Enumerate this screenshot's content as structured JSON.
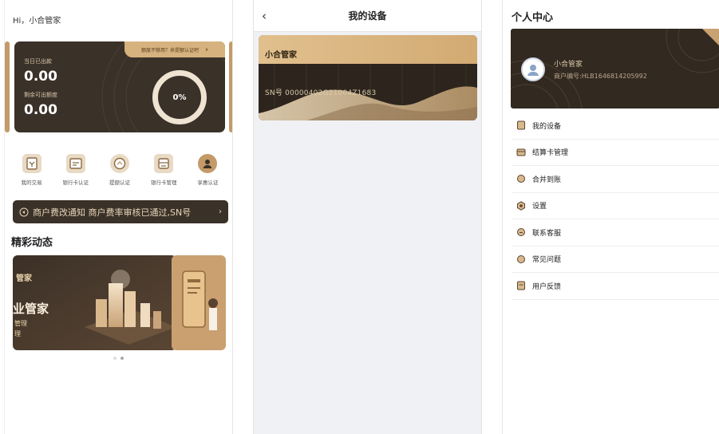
{
  "home": {
    "greeting": "Hi，小合管家",
    "quota_banner": "额度不够用？来提额认证吧",
    "quota_banner_arrow": "›",
    "today_label": "当日已出款",
    "today_value": "0.00",
    "remaining_label": "剩余可出额度",
    "remaining_value": "0.00",
    "progress_text": "0%",
    "quick_items": [
      {
        "label": "我的交易",
        "icon": "transaction-icon"
      },
      {
        "label": "银行卡认证",
        "icon": "bank-card-auth-icon"
      },
      {
        "label": "提额认证",
        "icon": "raise-limit-icon"
      },
      {
        "label": "银行卡管理",
        "icon": "bank-card-manage-icon"
      },
      {
        "label": "享惠认证",
        "icon": "benefit-auth-icon"
      }
    ],
    "notice_text": "商户费改通知  商户费率审核已通过,SN号",
    "notice_arrow": "›",
    "section_title": "精彩动态",
    "banner_text_1": "管家",
    "banner_text_2": "业管家",
    "banner_text_3": "管理",
    "banner_text_4": "理"
  },
  "device": {
    "back_icon": "‹",
    "title": "我的设备",
    "card_name": "小合管家",
    "card_sn": "SN号   00000402G21004Z1683"
  },
  "profile": {
    "title": "个人中心",
    "name": "小合管家",
    "merchant_id": "商户编号:HLB1646814205992",
    "menu": [
      {
        "label": "我的设备",
        "icon": "device-icon"
      },
      {
        "label": "结算卡管理",
        "icon": "card-icon"
      },
      {
        "label": "合并到账",
        "icon": "merge-icon"
      },
      {
        "label": "设置",
        "icon": "settings-icon"
      },
      {
        "label": "联系客服",
        "icon": "service-icon"
      },
      {
        "label": "常见问题",
        "icon": "faq-icon"
      },
      {
        "label": "用户反馈",
        "icon": "feedback-icon"
      }
    ]
  },
  "colors": {
    "dark_card": "#3a3129",
    "gold": "#d6b27e",
    "cream": "#efe4d2"
  }
}
